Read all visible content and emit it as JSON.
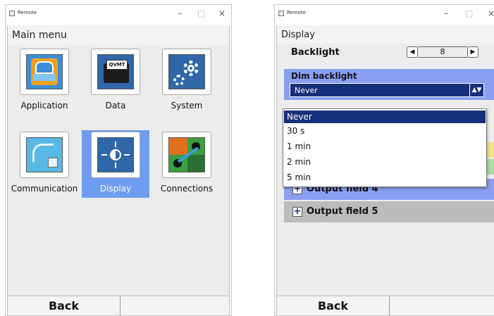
{
  "left_window": {
    "title": "Remote",
    "screen_title": "Main menu",
    "tiles": [
      {
        "label": "Application",
        "icon": "application-icon"
      },
      {
        "label": "Data",
        "icon": "data-folder-icon",
        "icon_text": "QVMT"
      },
      {
        "label": "System",
        "icon": "system-gears-icon"
      },
      {
        "label": "Communication",
        "icon": "communication-cable-icon"
      },
      {
        "label": "Display",
        "icon": "display-brightness-icon",
        "selected": true
      },
      {
        "label": "Connections",
        "icon": "connections-icon"
      }
    ],
    "footer": {
      "back_label": "Back"
    }
  },
  "right_window": {
    "title": "Remote",
    "screen_title": "Display",
    "backlight": {
      "label": "Backlight",
      "value": "8"
    },
    "dim_backlight": {
      "label": "Dim backlight",
      "selected_value": "Never"
    },
    "dropdown_options": [
      "Never",
      "30 s",
      "1 min",
      "2 min",
      "5 min"
    ],
    "output_fields": [
      {
        "label": "Output field 4"
      },
      {
        "label": "Output field 5"
      }
    ],
    "footer": {
      "back_label": "Back"
    }
  },
  "colors": {
    "selection_blue": "#6e9cf0",
    "dim_panel": "#8a9ef2",
    "dark_navy": "#17307a",
    "output4_bg": "#8a9ef2",
    "output5_bg": "#bcbcbc",
    "strip_yellow": "#f4e08a",
    "strip_green": "#a8dca0"
  }
}
